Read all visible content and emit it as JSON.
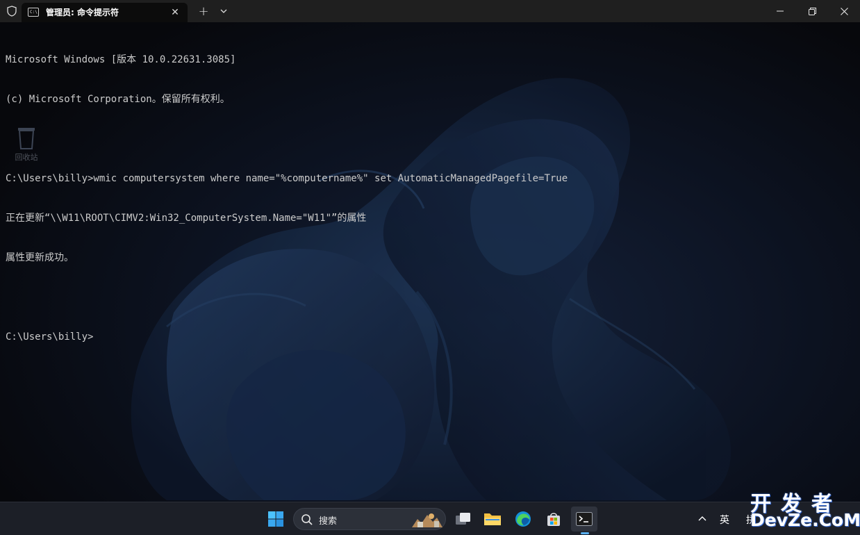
{
  "window": {
    "tab_title": "管理员: 命令提示符",
    "tab_icon_text": "C:\\",
    "new_tab_symbol": "+",
    "close_symbol": "✕"
  },
  "terminal": {
    "lines": [
      "Microsoft Windows [版本 10.0.22631.3085]",
      "(c) Microsoft Corporation。保留所有权利。",
      "",
      "C:\\Users\\billy>wmic computersystem where name=\"%computername%\" set AutomaticManagedPagefile=True",
      "正在更新“\\\\W11\\ROOT\\CIMV2:Win32_ComputerSystem.Name=\"W11\"”的属性",
      "属性更新成功。",
      "",
      "C:\\Users\\billy>"
    ]
  },
  "desktop": {
    "recycle_bin_label": "回收站"
  },
  "taskbar": {
    "search_placeholder": "搜索",
    "ime_indicator": "英",
    "tray_partial": "拼"
  },
  "watermark": {
    "top": "开发者",
    "bottom": "DevZe.CoM"
  },
  "colors": {
    "terminal_text": "#cccccc",
    "titlebar_bg": "#1f1f1f",
    "taskbar_bg": "#1c1f27",
    "accent_blue": "#5ab0f0"
  }
}
